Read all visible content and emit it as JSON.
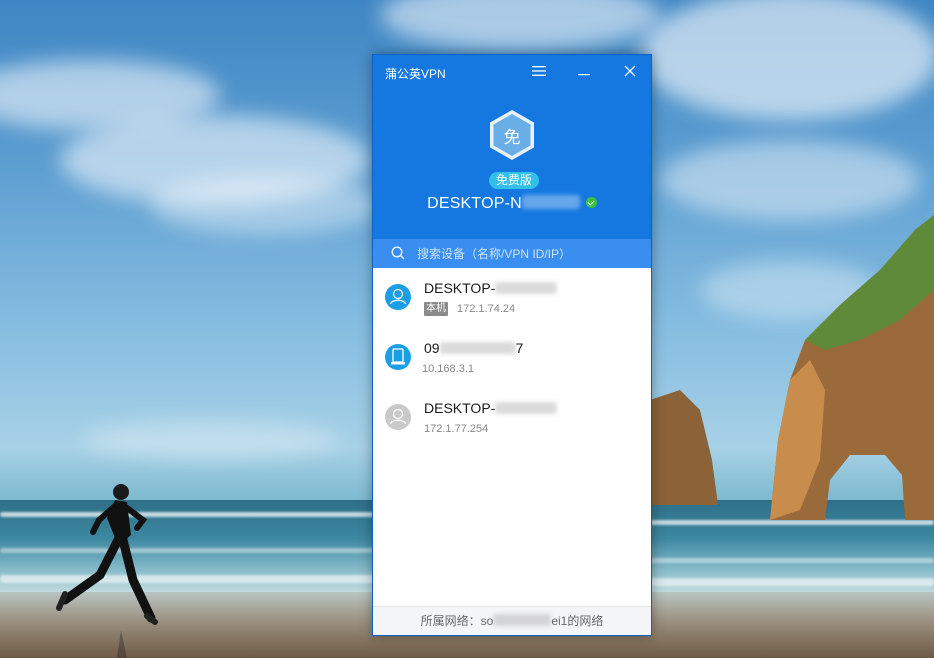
{
  "window": {
    "title": "蒲公英VPN",
    "menu_icon": "hamburger-icon",
    "minimize_icon": "minimize-icon",
    "close_icon": "close-icon"
  },
  "account": {
    "badge_char": "免",
    "plan_label": "免费版",
    "host_prefix": "DESKTOP-N",
    "status": "online",
    "status_color": "#37c43c"
  },
  "search": {
    "placeholder": "搜索设备（名称/VPN ID/IP）"
  },
  "devices": [
    {
      "name": "DESKTOP-",
      "tag": "本机",
      "ip": "172.1.74.24",
      "avatar_icon": "user-avatar-icon",
      "avatar_color": "#1a9fe6"
    },
    {
      "name_prefix": "09",
      "name_suffix": "7",
      "ip": "10.168.3.1",
      "avatar_icon": "router-icon",
      "avatar_color": "#1a9fe6"
    },
    {
      "name": "DESKTOP-",
      "ip": "172.1.77.254",
      "avatar_icon": "user-avatar-offline-icon",
      "avatar_color": "#c9c9c9"
    }
  ],
  "footer": {
    "prefix": "所属网络：so",
    "suffix": "ei1的网络"
  },
  "colors": {
    "header": "#1578e0",
    "search_bar": "#3a8ef0",
    "plan_badge": "#32c0ea"
  }
}
